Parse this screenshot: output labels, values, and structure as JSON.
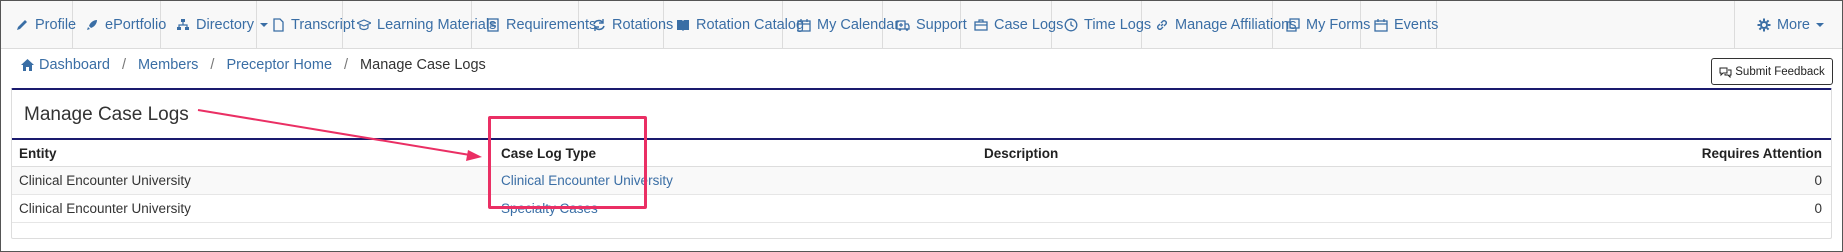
{
  "nav": {
    "items": [
      {
        "label": "Profile",
        "icon": "pencil-icon"
      },
      {
        "label": "ePortfolio",
        "icon": "rocket-icon"
      },
      {
        "label": "Directory",
        "icon": "sitemap-icon",
        "dropdown": true
      },
      {
        "label": "Transcript",
        "icon": "file-icon"
      },
      {
        "label": "Learning Materials",
        "icon": "graduation-cap-icon"
      },
      {
        "label": "Requirements",
        "icon": "list-icon"
      },
      {
        "label": "Rotations",
        "icon": "refresh-icon"
      },
      {
        "label": "Rotation Catalog",
        "icon": "book-icon"
      },
      {
        "label": "My Calendar",
        "icon": "calendar-icon"
      },
      {
        "label": "Support",
        "icon": "ambulance-icon"
      },
      {
        "label": "Case Logs",
        "icon": "briefcase-icon"
      },
      {
        "label": "Time Logs",
        "icon": "clock-icon"
      },
      {
        "label": "Manage Affiliations",
        "icon": "link-icon"
      },
      {
        "label": "My Forms",
        "icon": "clone-icon"
      },
      {
        "label": "Events",
        "icon": "calendar-icon"
      }
    ],
    "more_label": "More"
  },
  "breadcrumb": {
    "items": [
      "Dashboard",
      "Members",
      "Preceptor Home"
    ],
    "current": "Manage Case Logs",
    "separator": "/"
  },
  "feedback_button": "Submit Feedback",
  "panel": {
    "title": "Manage Case Logs",
    "columns": [
      "Entity",
      "Case Log Type",
      "Description",
      "Requires Attention"
    ],
    "rows": [
      {
        "entity": "Clinical Encounter University",
        "type": "Clinical Encounter University",
        "description": "",
        "attention": "0"
      },
      {
        "entity": "Clinical Encounter University",
        "type": "Specialty Cases",
        "description": "",
        "attention": "0"
      }
    ]
  },
  "colors": {
    "link": "#3a6ea5",
    "highlight": "#ea2f64",
    "panel_border": "#1a1a6e"
  }
}
